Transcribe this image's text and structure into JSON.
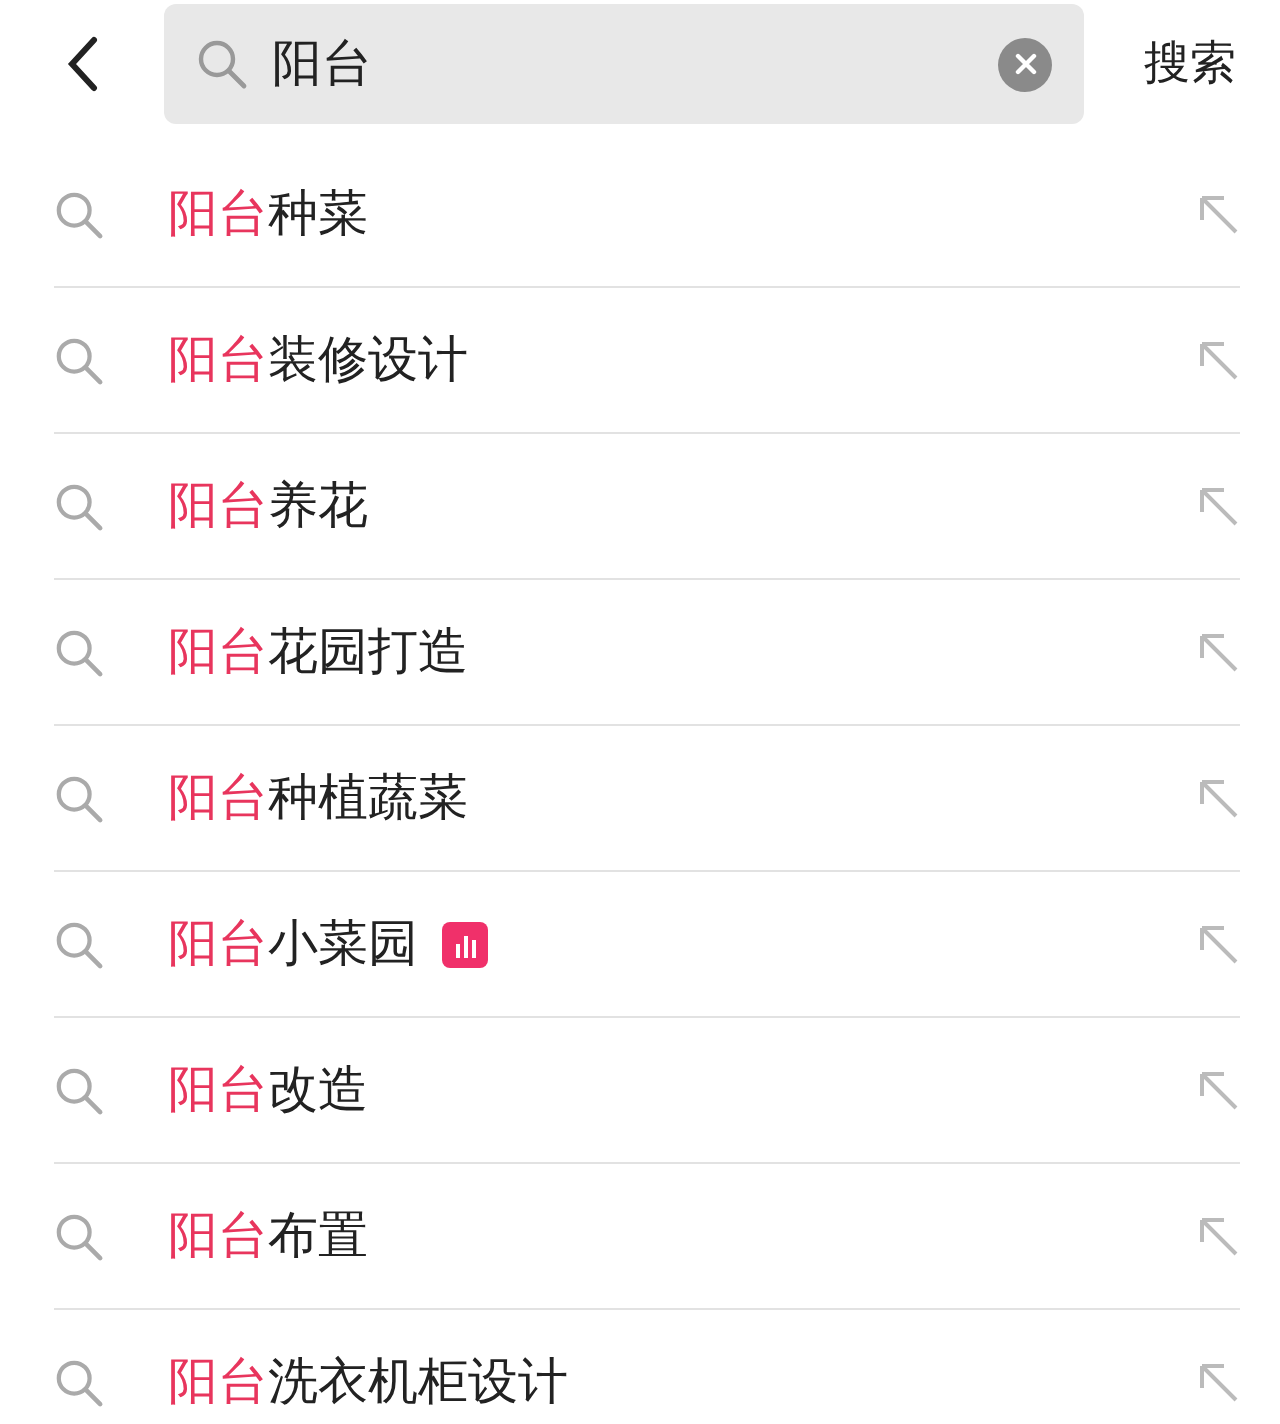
{
  "search": {
    "value": "阳台",
    "action": "搜索"
  },
  "suggestions": [
    {
      "match": "阳台",
      "rest": "种菜",
      "trending": false
    },
    {
      "match": "阳台",
      "rest": "装修设计",
      "trending": false
    },
    {
      "match": "阳台",
      "rest": "养花",
      "trending": false
    },
    {
      "match": "阳台",
      "rest": "花园打造",
      "trending": false
    },
    {
      "match": "阳台",
      "rest": "种植蔬菜",
      "trending": false
    },
    {
      "match": "阳台",
      "rest": "小菜园",
      "trending": true
    },
    {
      "match": "阳台",
      "rest": "改造",
      "trending": false
    },
    {
      "match": "阳台",
      "rest": "布置",
      "trending": false
    },
    {
      "match": "阳台",
      "rest": "洗衣机柜设计",
      "trending": false
    }
  ]
}
